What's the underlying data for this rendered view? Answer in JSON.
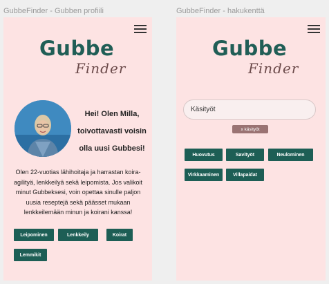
{
  "frames": [
    {
      "label": "GubbeFinder - Gubben profiili",
      "logo": {
        "main": "Gubbe",
        "sub": "Finder"
      },
      "profile": {
        "heading_lines": [
          "Hei! Olen Milla,",
          "toivottavasti voisin",
          "olla uusi Gubbesi!"
        ],
        "bio": "Olen 22-vuotias lähihoitaja ja harrastan koira-agilityä, lenkkeilyä sekä leipomista. Jos valikoit minut Gubbeksesi, voin opettaa sinulle paljon uusia reseptejä sekä päässet mukaan lenkkeilemään minun ja koirani kanssa!",
        "interests": [
          "Leipominen",
          "Lenkkeily",
          "Koirat",
          "Lemmikit"
        ]
      }
    },
    {
      "label": "GubbeFinder - hakukenttä",
      "logo": {
        "main": "Gubbe",
        "sub": "Finder"
      },
      "search": {
        "value": "Käsityöt",
        "active_filter": "x käsityöt"
      },
      "categories": [
        "Huovutus",
        "Savityöt",
        "Neulominen",
        "Virkkaaminen",
        "Villapaidat"
      ]
    }
  ],
  "colors": {
    "background": "#fde3e3",
    "accent": "#1d5e55",
    "filter_chip": "#9a7373"
  }
}
